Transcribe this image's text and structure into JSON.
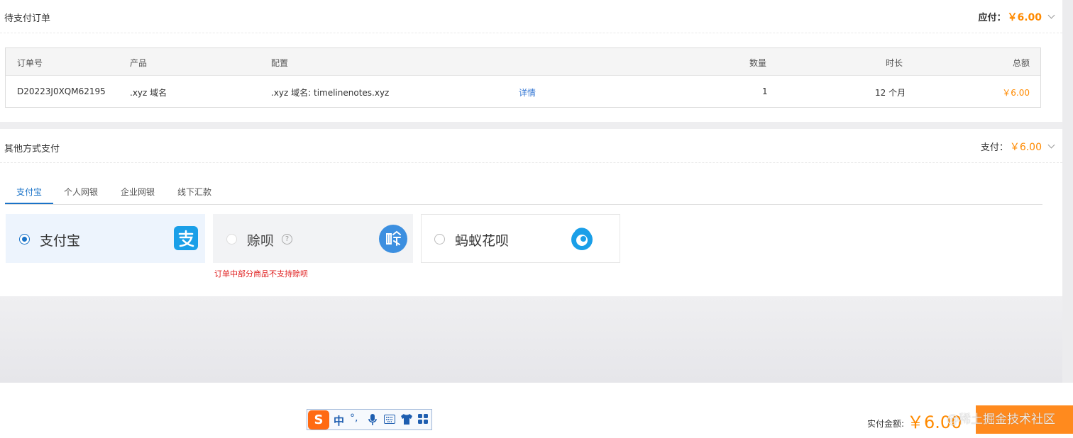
{
  "pending_order": {
    "title": "待支付订单",
    "due_label": "应付：",
    "due_amount": "￥6.00",
    "table": {
      "headers": [
        "订单号",
        "产品",
        "配置",
        "数量",
        "时长",
        "总额"
      ],
      "rows": [
        {
          "order_no": "D20223J0XQM62195",
          "product": ".xyz 域名",
          "config": ".xyz 域名: timelinenotes.xyz",
          "detail_link": "详情",
          "quantity": "1",
          "duration": "12 个月",
          "total": "￥6.00"
        }
      ]
    }
  },
  "other_payment": {
    "title": "其他方式支付",
    "pay_label": "支付：",
    "pay_amount": "￥6.00",
    "tabs": [
      {
        "label": "支付宝",
        "active": true
      },
      {
        "label": "个人网银",
        "active": false
      },
      {
        "label": "企业网银",
        "active": false
      },
      {
        "label": "线下汇款",
        "active": false
      }
    ],
    "methods": [
      {
        "label": "支付宝",
        "selected": true,
        "disabled": false,
        "icon": "alipay-icon"
      },
      {
        "label": "赊呗",
        "selected": false,
        "disabled": true,
        "icon": "shebei-icon",
        "help_glyph": "?"
      },
      {
        "label": "蚂蚁花呗",
        "selected": false,
        "disabled": false,
        "icon": "huabei-icon"
      }
    ],
    "warning": "订单中部分商品不支持赊呗"
  },
  "bottom": {
    "paid_label": "实付金额:",
    "paid_amount": "￥6.00",
    "watermark": "@稀土掘金技术社区"
  },
  "ime_toolbar": {
    "logo": "S",
    "mode": "中",
    "punct": "°,",
    "icons": [
      "microphone-icon",
      "keyboard-icon",
      "skin-icon",
      "toolbox-icon"
    ]
  },
  "colors": {
    "accent_orange": "#ff8a00",
    "link_blue": "#1a73c8",
    "warning_red": "#e02020",
    "alipay_blue": "#1a9fe8"
  }
}
